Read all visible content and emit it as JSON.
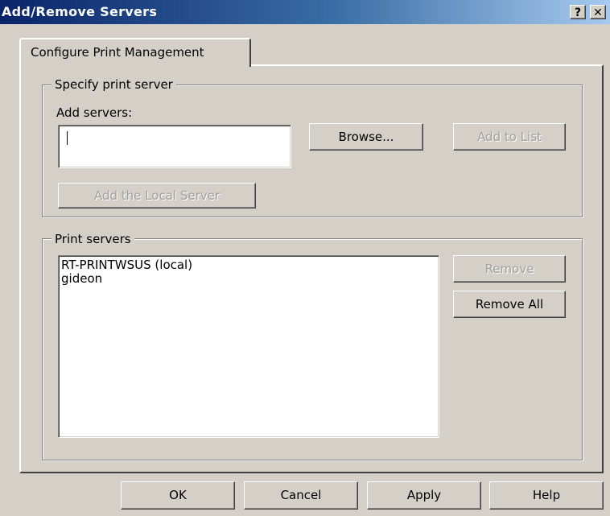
{
  "window": {
    "title": "Add/Remove Servers",
    "help_glyph": "?",
    "close_glyph": "✕"
  },
  "tabs": [
    {
      "label": "Configure Print Management",
      "selected": true
    }
  ],
  "specify_group": {
    "legend": "Specify print server",
    "add_label": "Add servers:",
    "add_input_value": "",
    "browse_label": "Browse...",
    "add_to_list_label": "Add to List",
    "add_local_label": "Add the Local Server"
  },
  "servers_group": {
    "legend": "Print servers",
    "items": [
      "RT-PRINTWSUS (local)",
      "gideon"
    ],
    "remove_label": "Remove",
    "remove_all_label": "Remove All"
  },
  "footer": {
    "ok_label": "OK",
    "cancel_label": "Cancel",
    "apply_label": "Apply",
    "help_label": "Help"
  },
  "colors": {
    "dialog_face": "#d4d0c8",
    "titlebar_start": "#0a246a",
    "titlebar_end": "#a6caf0",
    "disabled_text": "#a0a0a0"
  }
}
